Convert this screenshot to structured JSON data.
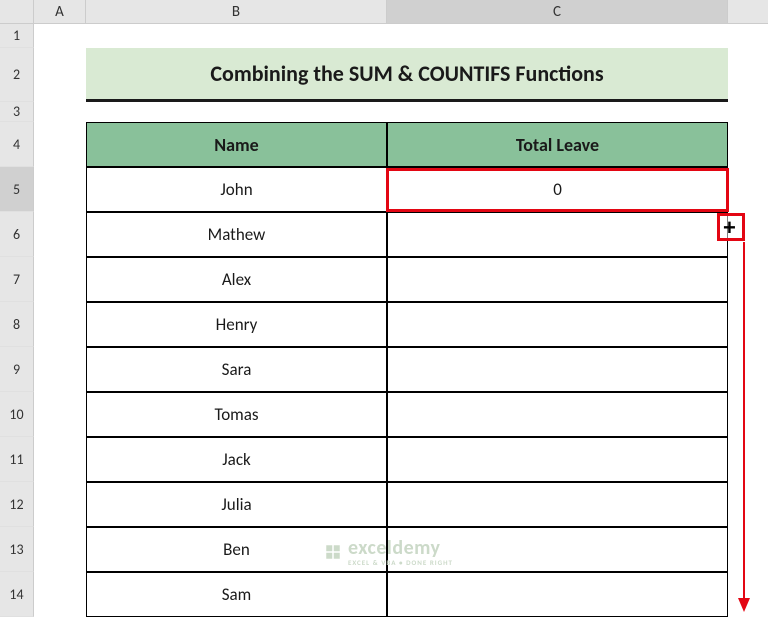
{
  "columns": {
    "a": "A",
    "b": "B",
    "c": "C"
  },
  "rows": [
    "1",
    "2",
    "3",
    "4",
    "5",
    "6",
    "7",
    "8",
    "9",
    "10",
    "11",
    "12",
    "13",
    "14"
  ],
  "title": "Combining the SUM & COUNTIFS Functions",
  "headers": {
    "name": "Name",
    "total_leave": "Total Leave"
  },
  "data": [
    {
      "name": "John",
      "total_leave": "0"
    },
    {
      "name": "Mathew",
      "total_leave": ""
    },
    {
      "name": "Alex",
      "total_leave": ""
    },
    {
      "name": "Henry",
      "total_leave": ""
    },
    {
      "name": "Sara",
      "total_leave": ""
    },
    {
      "name": "Tomas",
      "total_leave": ""
    },
    {
      "name": "Jack",
      "total_leave": ""
    },
    {
      "name": "Julia",
      "total_leave": ""
    },
    {
      "name": "Ben",
      "total_leave": ""
    },
    {
      "name": "Sam",
      "total_leave": ""
    }
  ],
  "watermark": {
    "brand": "exceldemy",
    "tagline": "EXCEL & VBA • DONE RIGHT"
  },
  "fill_cursor": "+"
}
